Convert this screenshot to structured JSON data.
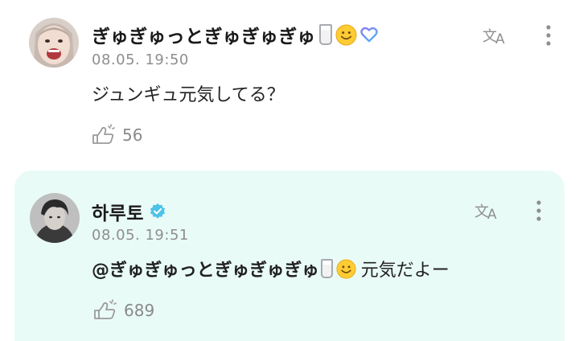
{
  "comments": [
    {
      "author": "ぎゅぎゅっとぎゅぎゅぎゅ",
      "timestamp": "08.05. 19:50",
      "text": "ジュンギュ元気してる？",
      "likes": "56",
      "icons": [
        "milk-glass-emoji",
        "smiling-face-emoji",
        "blue-purple-heart-icon"
      ]
    },
    {
      "author": "하루토",
      "verified": true,
      "timestamp": "08.05. 19:51",
      "mention": "@ぎゅぎゅっとぎゅぎゅぎゅ",
      "text": "元気だよー",
      "likes": "689",
      "icons": [
        "verified-badge-icon",
        "milk-glass-emoji",
        "smiling-face-emoji"
      ]
    }
  ],
  "colors": {
    "reply_background": "#e9fbf6",
    "verified": "#4ec2e8",
    "secondary_text": "#8e8e8e",
    "icon_gray": "#9a9a9a"
  }
}
